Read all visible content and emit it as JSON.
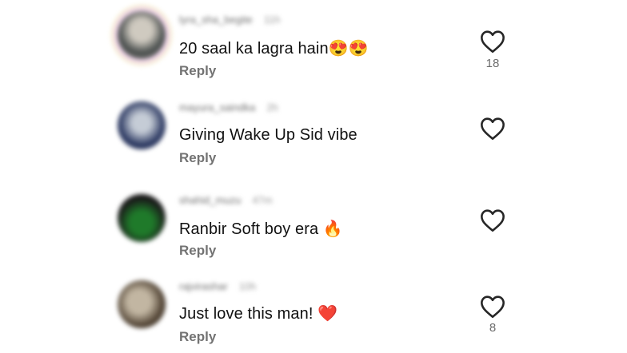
{
  "comments": [
    {
      "username": "lyra_sha_begite",
      "time": "11h",
      "text": "20 saal ka lagra hain😍😍",
      "reply_label": "Reply",
      "like_count": "18",
      "avatar_colors": [
        "#cfcac0",
        "#4a4f4e"
      ]
    },
    {
      "username": "mayura_saindka",
      "time": "2h",
      "text": "Giving Wake Up Sid vibe",
      "reply_label": "Reply",
      "like_count": "",
      "avatar_colors": [
        "#c5ccd6",
        "#2d3a63"
      ]
    },
    {
      "username": "shahid_muzu",
      "time": "47m",
      "text": "Ranbir Soft boy era 🔥",
      "reply_label": "Reply",
      "like_count": "",
      "avatar_colors": [
        "#1f7a2a",
        "#1a1a1a"
      ]
    },
    {
      "username": "rajvirashar",
      "time": "10h",
      "text": "Just love this man! ❤️",
      "reply_label": "Reply",
      "like_count": "8",
      "avatar_colors": [
        "#c2b6a2",
        "#4d3f30"
      ]
    }
  ],
  "colors": {
    "text": "#111111",
    "reply": "#737373",
    "meta": "#6f6f6f",
    "heart_outline": "#262626"
  },
  "icons": {
    "like": "heart-outline-icon"
  }
}
